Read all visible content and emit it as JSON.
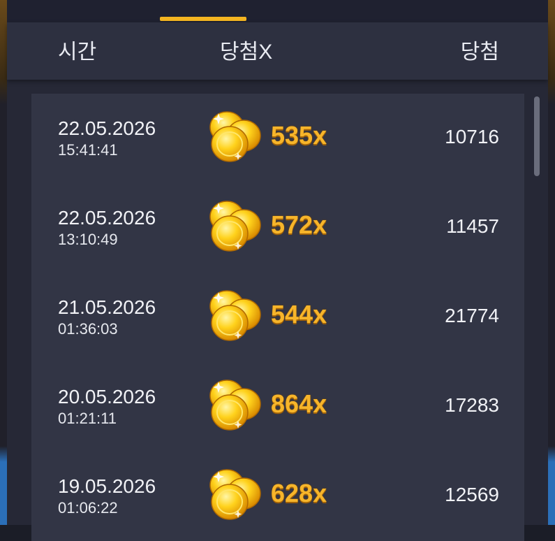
{
  "header": {
    "time_label": "시간",
    "multiplier_label": "당첨X",
    "win_label": "당첨"
  },
  "rows": [
    {
      "date": "22.05.2026",
      "time": "15:41:41",
      "multiplier": "535x",
      "win": "10716"
    },
    {
      "date": "22.05.2026",
      "time": "13:10:49",
      "multiplier": "572x",
      "win": "11457"
    },
    {
      "date": "21.05.2026",
      "time": "01:36:03",
      "multiplier": "544x",
      "win": "21774"
    },
    {
      "date": "20.05.2026",
      "time": "01:21:11",
      "multiplier": "864x",
      "win": "17283"
    },
    {
      "date": "19.05.2026",
      "time": "01:06:22",
      "multiplier": "628x",
      "win": "12569"
    }
  ],
  "colors": {
    "accent": "#f4b521",
    "multiplier_text": "#f7b52a",
    "row_background": "#323545"
  },
  "icons": {
    "coin": "gold-coin-stack-icon"
  }
}
